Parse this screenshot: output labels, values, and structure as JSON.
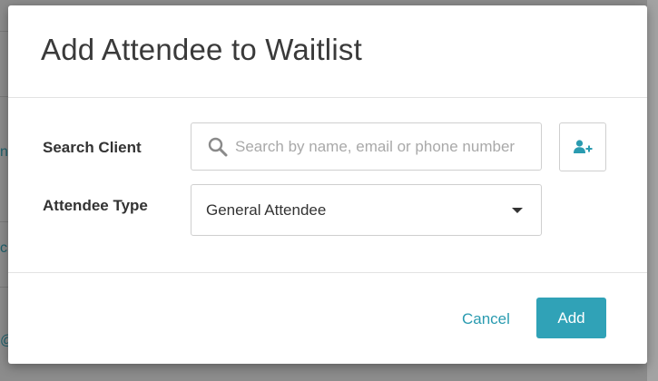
{
  "backdrop": {
    "fragments": [
      "ne",
      "c",
      "@"
    ]
  },
  "modal": {
    "title": "Add Attendee to Waitlist",
    "search_client": {
      "label": "Search Client",
      "placeholder": "Search by name, email or phone number",
      "value": "",
      "icon": "search-icon",
      "add_button_icon": "add-user-icon"
    },
    "attendee_type": {
      "label": "Attendee Type",
      "selected": "General Attendee",
      "icon": "caret-down-icon"
    },
    "footer": {
      "cancel_label": "Cancel",
      "add_label": "Add"
    }
  },
  "colors": {
    "accent": "#30a2b7",
    "link": "#2a9bb0",
    "text": "#333333",
    "border": "#cfcfcf"
  }
}
